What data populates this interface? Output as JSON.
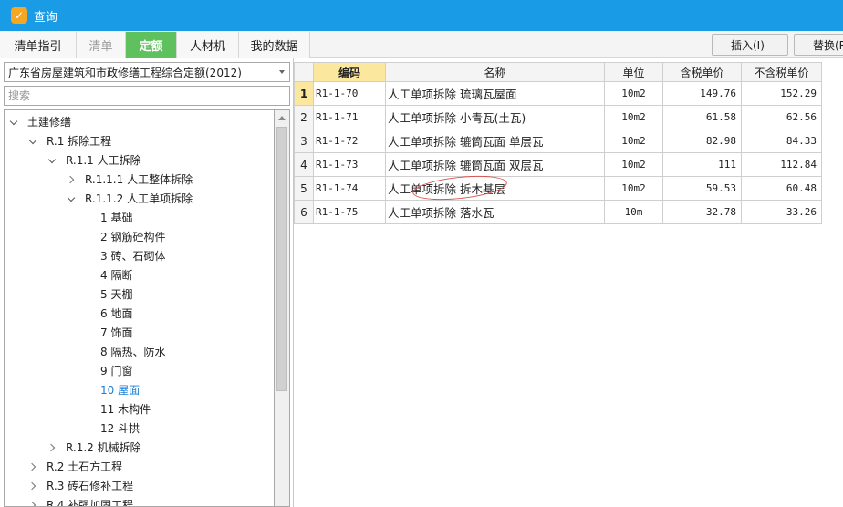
{
  "window": {
    "title": "查询",
    "app_icon_glyph": "✓"
  },
  "tabs": [
    {
      "label": "清单指引",
      "state": "normal"
    },
    {
      "label": "清单",
      "state": "inactive"
    },
    {
      "label": "定额",
      "state": "active"
    },
    {
      "label": "人材机",
      "state": "normal"
    },
    {
      "label": "我的数据",
      "state": "normal"
    }
  ],
  "toolbar": {
    "insert_label": "插入(I)",
    "replace_label": "替换(R"
  },
  "left": {
    "library": "广东省房屋建筑和市政修缮工程综合定额(2012)",
    "search_placeholder": "搜索",
    "tree": [
      {
        "label": "土建修缮",
        "state": "expanded"
      },
      {
        "label": "R.1 拆除工程",
        "state": "expanded"
      },
      {
        "label": "R.1.1 人工拆除",
        "state": "expanded"
      },
      {
        "label": "R.1.1.1 人工整体拆除",
        "state": "collapsed"
      },
      {
        "label": "R.1.1.2 人工单项拆除",
        "state": "expanded"
      },
      {
        "label": "1 基础",
        "state": "leaf"
      },
      {
        "label": "2 钢筋砼构件",
        "state": "leaf"
      },
      {
        "label": "3 砖、石砌体",
        "state": "leaf"
      },
      {
        "label": "4 隔断",
        "state": "leaf"
      },
      {
        "label": "5 天棚",
        "state": "leaf"
      },
      {
        "label": "6 地面",
        "state": "leaf"
      },
      {
        "label": "7 饰面",
        "state": "leaf"
      },
      {
        "label": "8 隔热、防水",
        "state": "leaf"
      },
      {
        "label": "9 门窗",
        "state": "leaf"
      },
      {
        "label": "10 屋面",
        "state": "leaf",
        "selected": true
      },
      {
        "label": "11 木构件",
        "state": "leaf"
      },
      {
        "label": "12 斗拱",
        "state": "leaf"
      },
      {
        "label": "R.1.2 机械拆除",
        "state": "collapsed"
      },
      {
        "label": "R.2 土石方工程",
        "state": "collapsed"
      },
      {
        "label": "R.3 砖石修补工程",
        "state": "collapsed"
      },
      {
        "label": "R.4 补强加固工程",
        "state": "collapsed"
      }
    ]
  },
  "grid": {
    "headers": [
      "",
      "编码",
      "名称",
      "单位",
      "含税单价",
      "不含税单价"
    ],
    "rows": [
      {
        "num": "1",
        "code": "R1-1-70",
        "name": "人工单项拆除 琉璃瓦屋面",
        "unit": "10m2",
        "tax_price": "149.76",
        "notax_price": "152.29"
      },
      {
        "num": "2",
        "code": "R1-1-71",
        "name": "人工单项拆除 小青瓦(土瓦)",
        "unit": "10m2",
        "tax_price": "61.58",
        "notax_price": "62.56"
      },
      {
        "num": "3",
        "code": "R1-1-72",
        "name": "人工单项拆除 辘筒瓦面 单层瓦",
        "unit": "10m2",
        "tax_price": "82.98",
        "notax_price": "84.33"
      },
      {
        "num": "4",
        "code": "R1-1-73",
        "name": "人工单项拆除 辘筒瓦面 双层瓦",
        "unit": "10m2",
        "tax_price": "111",
        "notax_price": "112.84"
      },
      {
        "num": "5",
        "code": "R1-1-74",
        "name": "人工单项拆除 拆木基层",
        "unit": "10m2",
        "tax_price": "59.53",
        "notax_price": "60.48"
      },
      {
        "num": "6",
        "code": "R1-1-75",
        "name": "人工单项拆除 落水瓦",
        "unit": "10m",
        "tax_price": "32.78",
        "notax_price": "33.26"
      }
    ]
  },
  "colors": {
    "titlebar": "#1a9be6",
    "active_tab": "#5fc15d",
    "header_highlight": "#fbe89e",
    "selected_tree": "#1a7fd6",
    "annotation": "#d9534f"
  }
}
